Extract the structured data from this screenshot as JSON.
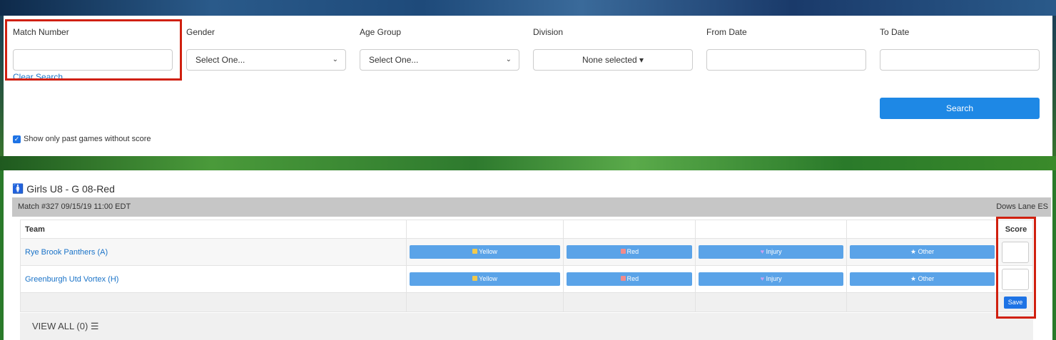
{
  "search": {
    "match_number": {
      "label": "Match Number",
      "value": "",
      "clear_label": "Clear Search"
    },
    "gender": {
      "label": "Gender",
      "selected": "Select One..."
    },
    "age_group": {
      "label": "Age Group",
      "selected": "Select One..."
    },
    "division": {
      "label": "Division",
      "selected": "None selected ▾"
    },
    "from_date": {
      "label": "From Date",
      "value": ""
    },
    "to_date": {
      "label": "To Date",
      "value": ""
    },
    "search_label": "Search",
    "past_games_label": "Show only past games without score",
    "past_games_checked": true
  },
  "results": {
    "division_title": "Girls U8 - G 08-Red",
    "match": {
      "info": "Match #327 09/15/19 11:00 EDT",
      "venue": "Dows Lane ES",
      "headers": {
        "team": "Team",
        "score": "Score"
      },
      "teams": [
        {
          "name": "Rye Brook Panthers (A)",
          "score": ""
        },
        {
          "name": "Greenburgh Utd Vortex (H)",
          "score": ""
        }
      ],
      "buttons": {
        "yellow": "Yellow",
        "red": "Red",
        "injury": "Injury",
        "other": "Other"
      },
      "save_label": "Save"
    },
    "view_all_label": "VIEW ALL (0)"
  },
  "colors": {
    "accent": "#1e88e5",
    "card_button": "#5aa3e8",
    "link": "#1a73c8",
    "highlight": "#d0200f",
    "yellow_card": "#f2c94c",
    "red_card": "#f28b8b",
    "injury": "#b58ae6"
  }
}
